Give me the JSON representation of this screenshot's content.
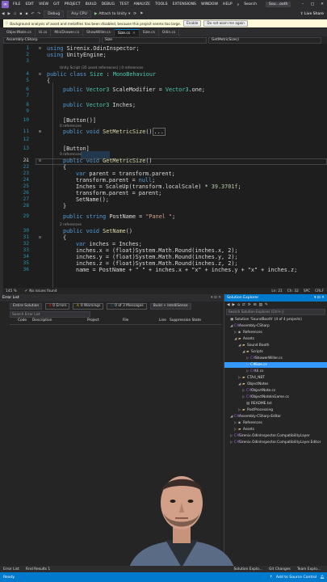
{
  "menu": {
    "items": [
      "FILE",
      "EDIT",
      "VIEW",
      "GIT",
      "PROJECT",
      "BUILD",
      "DEBUG",
      "TEST",
      "ANALYZE",
      "TOOLS",
      "EXTENSIONS",
      "WINDOW",
      "HELP"
    ],
    "search": "Search",
    "solution_badge": "Sou...ooth"
  },
  "toolbar": {
    "config": "Debug",
    "platform": "Any CPU",
    "attach": "Attach to Unity",
    "live_share": "Live Share"
  },
  "infobar": {
    "message": "Background analysis of asset and metafiles has been disabled, because this project seems too large.",
    "button1": "Enable",
    "button2": "Do not warn me again"
  },
  "tabs": [
    {
      "label": "ObjectNote.cs",
      "active": false
    },
    {
      "label": "Ui.cs",
      "active": false
    },
    {
      "label": "MiniDrawer.cs",
      "active": false
    },
    {
      "label": "ShowWiller.cs",
      "active": false
    },
    {
      "label": "Size.cs",
      "active": true
    },
    {
      "label": "Size.cs",
      "active": false
    },
    {
      "label": "Odin.cs",
      "active": false
    }
  ],
  "navbar": {
    "project": "Assembly-CSharp",
    "klass": "Size",
    "member": "GetMetricSize()"
  },
  "code": {
    "line_numbers": [
      "1",
      "2",
      "3",
      "4",
      "5",
      "6",
      "7",
      "8",
      "9",
      "10",
      "11",
      "12",
      "13",
      "20",
      "21",
      "22",
      "23",
      "24",
      "25",
      "26",
      "27",
      "28",
      "29",
      "30",
      "31",
      "32",
      "33",
      "34",
      "35",
      "36"
    ],
    "lens_unity": "Unity Script (35 asset references) | 0 references",
    "lens_0ref_a": "0 references",
    "lens_0ref_b": "0 references",
    "lens_2ref": "2 references",
    "l1_using": "using",
    "l1_ns": "Sirenix.OdinInspector;",
    "l2_ns": "UnityEngine;",
    "l4_decl": "public class",
    "l4_name": "Size",
    "l4_base": "MonoBehaviour",
    "brace_open": "{",
    "brace_close": "}",
    "l6_mod": "public",
    "l6_type": "Vector3",
    "l6_rest": "ScaleModifier = ",
    "l6_val": "Vector3",
    "l6_end": ".one;",
    "l8_rest": "Inches;",
    "attr_button": "[Button()]",
    "attr_button2": "[Button]",
    "void_kw": "void",
    "m1_name": "SetMetricSize",
    "m1_tail": "()",
    "collapsed": "...",
    "m2_name": "GetMetricSize",
    "var_kw": "var",
    "parent_assign": "parent = transform.parent;",
    "parent_null": "transform.parent = ",
    "null_kw": "null",
    "inches_scale": "Inches = ScaleUp(transform.localScale) * ",
    "inches_num": "39.3701f",
    "parent_back": "transform.parent = parent;",
    "set_name_call": "SetName();",
    "postname_mod": "public",
    "postname_type": "string",
    "postname_rest": "PostName = ",
    "postname_val": "\"Panel \"",
    "setname_name": "SetName",
    "inches_var": "inches = Inches;",
    "round_x": "inches.x = (float)System.Math.Round(inches.x, 2);",
    "round_y": "inches.y = (float)System.Math.Round(inches.y, 2);",
    "round_z": "inches.z = (float)System.Math.Round(inches.z, 2);",
    "name_line": "name = PostName + \" \" + inches.x + \"x\" + inches.y + \"x\" + inches.z;",
    "float_kw": "float",
    "semi": ";"
  },
  "editor_status": {
    "zoom": "145 %",
    "issues": "No issues found",
    "line": "Ln: 21",
    "col": "Ch: 32",
    "spc": "SPC",
    "crlf": "CRLF"
  },
  "error_list": {
    "title": "Error List",
    "scope": "Entire Solution",
    "errors": "0 Errors",
    "warnings": "0 Warnings",
    "messages": "0 of 3 Messages",
    "build": "Build + IntelliSense",
    "search_placeholder": "Search Error List",
    "columns": [
      "Code",
      "Description",
      "Project",
      "File",
      "Line",
      "Suppression State"
    ]
  },
  "solution_explorer": {
    "title": "Solution Explorer",
    "search_placeholder": "Search Solution Explorer (Ctrl+;)",
    "tree": [
      {
        "label": "Solution 'SoundBooth' (4 of 4 projects)",
        "indent": 0,
        "icon": "▣",
        "exp": ""
      },
      {
        "label": "Assembly-CSharp",
        "indent": 1,
        "icon": "C#",
        "exp": "◢"
      },
      {
        "label": "References",
        "indent": 2,
        "icon": "▪",
        "exp": "▷"
      },
      {
        "label": "Assets",
        "indent": 2,
        "icon": "▰",
        "exp": "◢"
      },
      {
        "label": "Sound Booth",
        "indent": 3,
        "icon": "▰",
        "exp": "◢"
      },
      {
        "label": "Scripts",
        "indent": 4,
        "icon": "▰",
        "exp": "◢"
      },
      {
        "label": "ShowerWiller.cs",
        "indent": 5,
        "icon": "C#",
        "exp": "▷"
      },
      {
        "label": "Size.cs",
        "indent": 5,
        "icon": "C#",
        "exp": "▷",
        "selected": true
      },
      {
        "label": "Ui.cs",
        "indent": 5,
        "icon": "C#",
        "exp": "▷"
      },
      {
        "label": "CTA4_NBT",
        "indent": 3,
        "icon": "▰",
        "exp": "▷"
      },
      {
        "label": "ObjectNotes",
        "indent": 3,
        "icon": "▰",
        "exp": "◢"
      },
      {
        "label": "ObjectNote.cs",
        "indent": 4,
        "icon": "C#",
        "exp": "▷"
      },
      {
        "label": "ObjectNoteInGame.cs",
        "indent": 4,
        "icon": "C#",
        "exp": "▷"
      },
      {
        "label": "README.txt",
        "indent": 4,
        "icon": "▤",
        "exp": ""
      },
      {
        "label": "PostProcessing",
        "indent": 3,
        "icon": "▰",
        "exp": "▷"
      },
      {
        "label": "Assembly-CSharp-Editor",
        "indent": 1,
        "icon": "C#",
        "exp": "◢"
      },
      {
        "label": "References",
        "indent": 2,
        "icon": "▪",
        "exp": "▷"
      },
      {
        "label": "Assets",
        "indent": 2,
        "icon": "▰",
        "exp": "▷"
      },
      {
        "label": "Sirenix.OdinInspector.CompatibilityLayer",
        "indent": 1,
        "icon": "C#",
        "exp": "▷"
      },
      {
        "label": "Sirenix.OdinInspector.CompatibilityLayer.Editor",
        "indent": 1,
        "icon": "C#",
        "exp": "▷"
      }
    ]
  },
  "bottom_tabs": {
    "left": [
      "Error List",
      "Find Results 1"
    ],
    "right": [
      "Solution Explo...",
      "Git Changes",
      "Team Explo..."
    ]
  },
  "status_bar": {
    "ready": "Ready",
    "add_source": "Add to Source Control"
  },
  "colors": {
    "accent": "#007acc",
    "keyword": "#569cd6",
    "type": "#4ec9b0",
    "string": "#d69d85",
    "number": "#b5cea8",
    "method": "#dcdcaa",
    "selection": "#3399ff"
  }
}
